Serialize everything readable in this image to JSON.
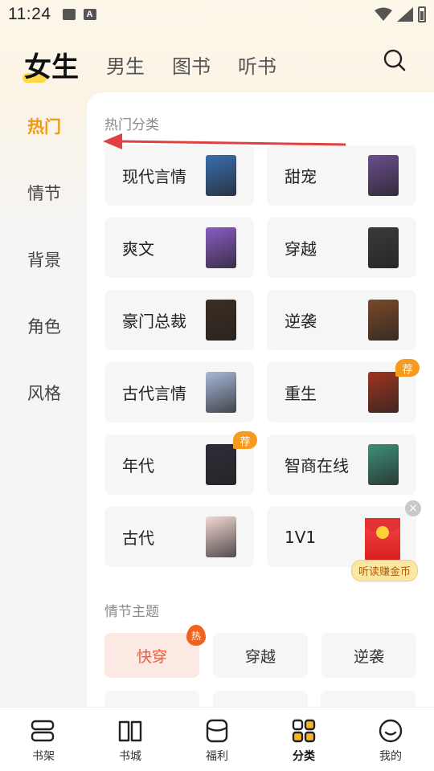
{
  "status_bar": {
    "time": "11:24",
    "icons": [
      "image-icon",
      "a-icon",
      "wifi-icon",
      "signal-icon",
      "battery-icon"
    ]
  },
  "top_tabs": [
    {
      "label": "女生",
      "active": true
    },
    {
      "label": "男生",
      "active": false
    },
    {
      "label": "图书",
      "active": false
    },
    {
      "label": "听书",
      "active": false
    }
  ],
  "left_nav": [
    {
      "label": "热门",
      "active": true
    },
    {
      "label": "情节",
      "active": false
    },
    {
      "label": "背景",
      "active": false
    },
    {
      "label": "角色",
      "active": false
    },
    {
      "label": "风格",
      "active": false
    }
  ],
  "hot_section": {
    "title": "热门分类",
    "categories": [
      {
        "label": "现代言情",
        "cover": "#3b6fb0",
        "badge": ""
      },
      {
        "label": "甜宠",
        "cover": "#6a4f8c",
        "badge": ""
      },
      {
        "label": "爽文",
        "cover": "#8a5cc4",
        "badge": ""
      },
      {
        "label": "穿越",
        "cover": "#3a3a3a",
        "badge": ""
      },
      {
        "label": "豪门总裁",
        "cover": "#3d2e22",
        "badge": ""
      },
      {
        "label": "逆袭",
        "cover": "#7a4a28",
        "badge": ""
      },
      {
        "label": "古代言情",
        "cover": "#a9b8d8",
        "badge": ""
      },
      {
        "label": "重生",
        "cover": "#a0341f",
        "badge": "荐"
      },
      {
        "label": "年代",
        "cover": "#2e2e3a",
        "badge": "荐"
      },
      {
        "label": "智商在线",
        "cover": "#3f8f7a",
        "badge": ""
      },
      {
        "label": "古代",
        "cover": "#f3d7d3",
        "badge": ""
      },
      {
        "label": "1V1",
        "cover": "",
        "badge": ""
      }
    ],
    "promo": {
      "label": "听读赚金币",
      "close": "×"
    }
  },
  "plot_section": {
    "title": "情节主题",
    "chips": [
      {
        "label": "快穿",
        "active": true,
        "badge": "热"
      },
      {
        "label": "穿越",
        "active": false,
        "badge": ""
      },
      {
        "label": "逆袭",
        "active": false,
        "badge": ""
      }
    ]
  },
  "bottom_nav": [
    {
      "label": "书架",
      "icon": "bookshelf-icon",
      "active": false
    },
    {
      "label": "书城",
      "icon": "book-open-icon",
      "active": false
    },
    {
      "label": "福利",
      "icon": "gift-bag-icon",
      "active": false
    },
    {
      "label": "分类",
      "icon": "grid-icon",
      "active": true
    },
    {
      "label": "我的",
      "icon": "smile-icon",
      "active": false
    }
  ],
  "colors": {
    "accent": "#f29a11",
    "arrow": "#e04040",
    "hot": "#ef5a3c"
  }
}
